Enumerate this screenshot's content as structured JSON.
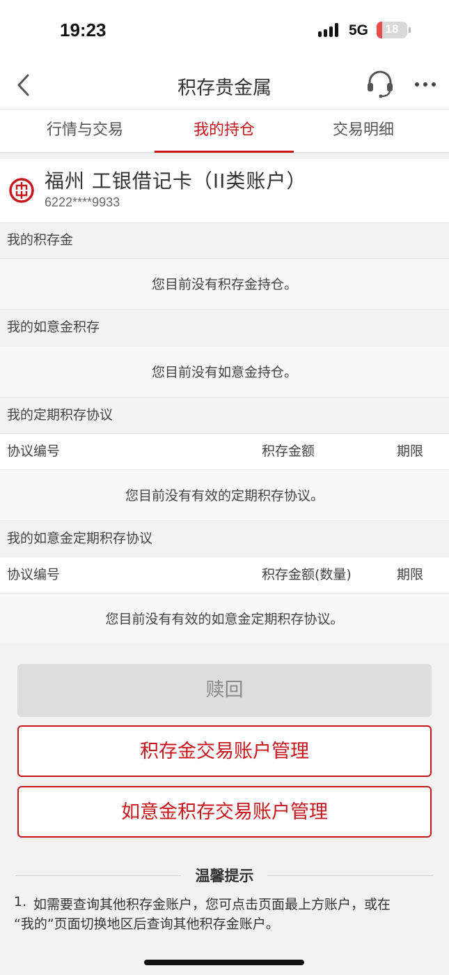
{
  "status_bar": {
    "time": "19:23",
    "network": "5G",
    "battery": "18",
    "battery_level_percent": 18
  },
  "nav": {
    "title": "积存贵金属",
    "back_icon": "chevron-left-icon",
    "service_icon": "headset-icon",
    "more_icon": "more-icon"
  },
  "tabs": [
    {
      "label": "行情与交易",
      "active": false
    },
    {
      "label": "我的持仓",
      "active": true
    },
    {
      "label": "交易明细",
      "active": false
    }
  ],
  "account": {
    "bank_icon": "icbc-logo-icon",
    "name": "福州  工银借记卡（II类账户）",
    "number": "6222****9933"
  },
  "sections": {
    "savings_gold": {
      "title": "我的积存金",
      "empty": "您目前没有积存金持仓。"
    },
    "ruyi_gold": {
      "title": "我的如意金积存",
      "empty": "您目前没有如意金持仓。"
    },
    "fixed_agreement": {
      "title": "我的定期积存协议",
      "columns": [
        "协议编号",
        "积存金额",
        "期限"
      ],
      "empty": "您目前没有有效的定期积存协议。"
    },
    "ruyi_fixed_agreement": {
      "title": "我的如意金定期积存协议",
      "columns": [
        "协议编号",
        "积存金额(数量)",
        "期限"
      ],
      "empty": "您目前没有有效的如意金定期积存协议。"
    }
  },
  "buttons": {
    "redeem": "赎回",
    "savings_account_manage": "积存金交易账户管理",
    "ruyi_account_manage": "如意金积存交易账户管理"
  },
  "tips": {
    "title": "温馨提示",
    "items": [
      {
        "number": "1.",
        "line1": "如需要查询其他积存金账户，您可点击页面最上方账户，或在",
        "line2": "“我的”页面切换地区后查询其他积存金账户。"
      }
    ]
  },
  "colors": {
    "accent": "#c8161d",
    "background": "#f2f2f2",
    "disabled": "#dddddd"
  }
}
